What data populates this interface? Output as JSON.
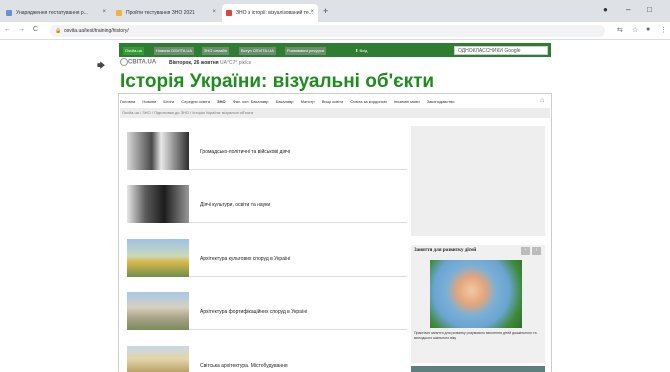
{
  "browser": {
    "tabs": [
      {
        "title": "Унарядження тестатування р...",
        "color": "#6b8fd6",
        "active": false
      },
      {
        "title": "Пройти тестування ЗНО 2021",
        "color": "#f0b341",
        "active": false
      },
      {
        "title": "ЗНО з історії: візуалізований те...",
        "color": "#d9453b",
        "active": true
      }
    ],
    "new_tab": "+",
    "window_controls": [
      "●",
      "–",
      "□"
    ],
    "nav": [
      "←",
      "→",
      "C"
    ],
    "lock": "🔒",
    "url": "osvita.ua/test/training/history/",
    "toolbar_icons": [
      "⇆",
      "☆",
      "●",
      "⋮"
    ]
  },
  "site_bar": {
    "links": [
      "Osvita.ua",
      "Новини OSVITA.UA",
      "ЗНО онлайн",
      "Вступ OSVITA.UA",
      "Розвиваючі ресурси",
      "⬆ Вхід"
    ],
    "search_placeholder": "ОДНОКЛАССНИКИ Google"
  },
  "logo": "CBITA.UA",
  "date": "Вівторок, 26 жовтня",
  "date_extra": "UA°C7° рік/ск",
  "page_title": "Історія України: візуальні об'єкти",
  "menu": [
    "Головна",
    "Новини",
    "Блоги",
    "Середня освіта",
    "ЗНО",
    "Фах. кол. Бакалавр",
    "Бакалавр",
    "Магістр",
    "Вищі освіти",
    "Освіта за кордоном",
    "Іноземні мови",
    "Законодавство"
  ],
  "menu_current": "ЗНО",
  "menu_icon": "⌂",
  "breadcrumb": "Osvita.ua  /  ЗНО  /  Підготовка до ЗНО  /  Історія України: візуальні об'єкти",
  "items": [
    {
      "label": "Громадсько-політичні та військові діячі",
      "img_bg": "linear-gradient(90deg,#d8d8d8 0%,#4a4a4a 40%,#e8e8e8 55%,#2e2e2e 100%)"
    },
    {
      "label": "Діячі культури, освіти та науки",
      "img_bg": "linear-gradient(90deg,#e6e6e6 0%,#5a5a5a 30%,#1c1c1c 60%,#999 100%)"
    },
    {
      "label": "Архітектура культових споруд в Україні",
      "img_bg": "linear-gradient(180deg,#9fc2e6 0%,#c9d9b8 45%,#d9b94a 60%,#6d8f4a 100%)"
    },
    {
      "label": "Архітектура фортифікаційних споруд в Україні",
      "img_bg": "linear-gradient(180deg,#a9c7e6 0%,#d6d1bf 40%,#a89f86 70%,#7a8c5a 100%)"
    },
    {
      "label": "Світська архітектура. Містобудування",
      "img_bg": "linear-gradient(180deg,#c8d8e8 0%,#e4d6a8 50%,#b9a26c 100%)"
    }
  ],
  "promo": {
    "title": "Заняття для розвитку дітей",
    "prev": "‹",
    "next": "›",
    "text": "Практичні заняття для розвитку розумового мислення дітей дошкільного та молодшого шкільного віку"
  }
}
